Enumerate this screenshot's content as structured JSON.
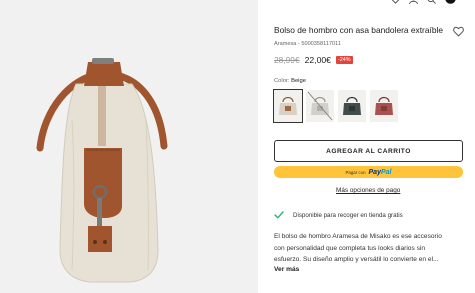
{
  "product": {
    "title": "Bolso de hombro con asa bandolera extraíble",
    "sku": "Aramesa - 5000358117011",
    "old_price": "28,99€",
    "price": "22,00€",
    "discount": "-24%"
  },
  "color": {
    "label": "Color:",
    "selected": "Beige",
    "swatches": [
      {
        "name": "Beige",
        "selected": true,
        "available": true,
        "hex": "#d8d0c2"
      },
      {
        "name": "Light gray",
        "selected": false,
        "available": false,
        "hex": "#d2d0ca"
      },
      {
        "name": "Dark green",
        "selected": false,
        "available": true,
        "hex": "#3f4e4b"
      },
      {
        "name": "Rose",
        "selected": false,
        "available": true,
        "hex": "#a8514f"
      }
    ]
  },
  "actions": {
    "add_to_cart": "AGREGAR AL CARRITO",
    "paypal_prefix": "Pagar con",
    "paypal_brand_a": "Pay",
    "paypal_brand_b": "Pal",
    "more_payment": "Más opciones de pago"
  },
  "availability": {
    "text": "Disponible para recoger en tienda gratis"
  },
  "description": {
    "lines": [
      "El bolso de hombro Aramesa de Misako es ese accesorio",
      "con personalidad que completa tus looks diarios sin",
      "esfuerzo. Su diseño amplio y versátil lo convierte en el..."
    ],
    "more": "Ver más"
  },
  "icons": {
    "topbar": [
      "heart-icon",
      "user-icon",
      "search-icon",
      "cart-icon"
    ],
    "wishlist": "heart-outline-icon",
    "availability": "check-icon"
  },
  "colors": {
    "accent_dark": "#222222",
    "discount_red": "#e2453c",
    "paypal_yellow": "#ffc439",
    "check_green": "#2ab573",
    "canvas_bag": "#e6e1d4",
    "leather": "#a0552e"
  }
}
